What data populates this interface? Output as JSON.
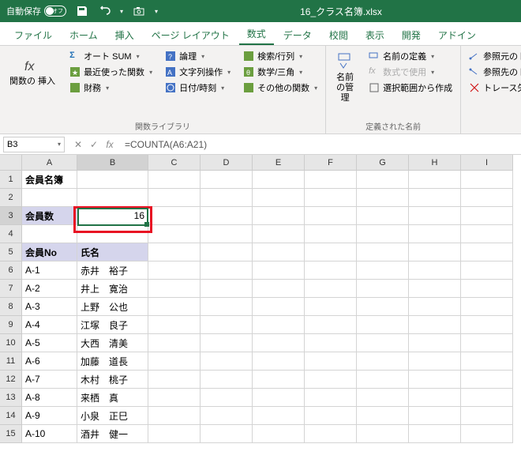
{
  "titlebar": {
    "autosave_label": "自動保存",
    "autosave_state": "オフ",
    "filename": "16_クラス名簿.xlsx"
  },
  "tabs": {
    "items": [
      "ファイル",
      "ホーム",
      "挿入",
      "ページ レイアウト",
      "数式",
      "データ",
      "校閲",
      "表示",
      "開発",
      "アドイン"
    ],
    "active": 4
  },
  "ribbon": {
    "insert_fn": "関数の\n挿入",
    "autosum": "オート SUM",
    "recent": "最近使った関数",
    "financial": "財務",
    "logical": "論理",
    "text": "文字列操作",
    "datetime": "日付/時刻",
    "lookup": "検索/行列",
    "math": "数学/三角",
    "more": "その他の関数",
    "group1_label": "関数ライブラリ",
    "name_mgr": "名前\nの管理",
    "define_name": "名前の定義",
    "use_formula": "数式で使用",
    "create_sel": "選択範囲から作成",
    "group2_label": "定義された名前",
    "trace_prec": "参照元のトレ",
    "trace_dep": "参照先のトレ",
    "remove_arr": "トレース矢印の"
  },
  "formula_bar": {
    "cell_ref": "B3",
    "formula": "=COUNTA(A6:A21)"
  },
  "columns": [
    "A",
    "B",
    "C",
    "D",
    "E",
    "F",
    "G",
    "H",
    "I"
  ],
  "rows_shown": 15,
  "sheet": {
    "a1": "会員名簿",
    "a3": "会員数",
    "b3": "16",
    "a5": "会員No",
    "b5": "氏名",
    "members": [
      {
        "no": "A-1",
        "name": "赤井　裕子"
      },
      {
        "no": "A-2",
        "name": "井上　寛治"
      },
      {
        "no": "A-3",
        "name": "上野　公也"
      },
      {
        "no": "A-4",
        "name": "江塚　良子"
      },
      {
        "no": "A-5",
        "name": "大西　清美"
      },
      {
        "no": "A-6",
        "name": "加藤　道長"
      },
      {
        "no": "A-7",
        "name": "木村　桃子"
      },
      {
        "no": "A-8",
        "name": "来栖　真"
      },
      {
        "no": "A-9",
        "name": "小泉　正巳"
      },
      {
        "no": "A-10",
        "name": "酒井　健一"
      }
    ]
  }
}
